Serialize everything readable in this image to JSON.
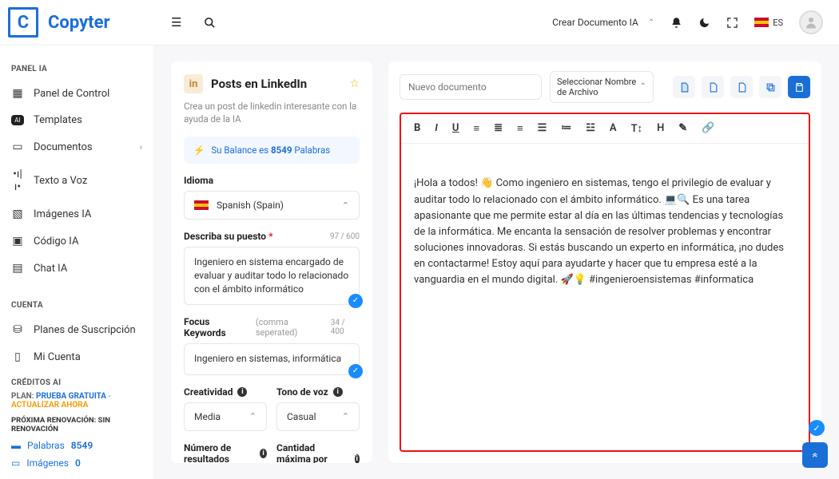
{
  "app": {
    "logo_letter": "C",
    "logo_text": "Copyter"
  },
  "topbar": {
    "crear_label": "Crear Documento IA",
    "lang_code": "ES"
  },
  "sidebar": {
    "section_panel": "PANEL IA",
    "items_panel": [
      {
        "icon": "grid",
        "label": "Panel de Control"
      },
      {
        "icon": "ai",
        "label": "Templates"
      },
      {
        "icon": "doc",
        "label": "Documentos",
        "chev": true
      },
      {
        "icon": "wave",
        "label": "Texto a Voz"
      },
      {
        "icon": "img",
        "label": "Imágenes IA"
      },
      {
        "icon": "code",
        "label": "Código IA"
      },
      {
        "icon": "chat",
        "label": "Chat IA"
      }
    ],
    "section_account": "CUENTA",
    "items_account": [
      {
        "icon": "plan",
        "label": "Planes de Suscripción"
      },
      {
        "icon": "user",
        "label": "Mi Cuenta"
      }
    ],
    "credits_head": "CRÉDITOS AI",
    "plan_prefix": "PLAN:",
    "plan_name": "PRUEBA GRATUITA",
    "plan_sep": "-",
    "plan_action": "ACTUALIZAR AHORA",
    "renov": "PRÓXIMA RENOVACIÓN: SIN RENOVACIÓN",
    "stat_words_label": "Palabras",
    "stat_words_value": "8549",
    "stat_images_label": "Imágenes",
    "stat_images_value": "0"
  },
  "template": {
    "badge": "in",
    "title": "Posts en LinkedIn",
    "desc": "Crea un post de linkedin interesante con la ayuda de la IA",
    "balance_prefix": "Su Balance es",
    "balance_num": "8549",
    "balance_suffix": "Palabras",
    "lang_label": "Idioma",
    "lang_value": "Spanish (Spain)",
    "desc_label": "Describa su puesto",
    "desc_counter": "97 / 600",
    "desc_value": "Ingeniero en sistema encargado de evaluar y auditar todo lo relacionado con el ámbito informático",
    "kw_label": "Focus Keywords",
    "kw_hint": "(comma seperated)",
    "kw_counter": "34 / 400",
    "kw_value": "Ingeniero en sistemas, informática",
    "creativity_label": "Creatividad",
    "creativity_value": "Media",
    "tone_label": "Tono de voz",
    "tone_value": "Casual",
    "results_label": "Número de resultados",
    "maxlen_label": "Cantidad máxima por resultado"
  },
  "document": {
    "new_placeholder": "Nuevo documento",
    "archive_label": "Seleccionar Nombre de Archivo",
    "body": "¡Hola a todos! 👋 Como ingeniero en sistemas, tengo el privilegio de evaluar y auditar todo lo relacionado con el ámbito informático. 💻🔍 Es una tarea apasionante que me permite estar al día en las últimas tendencias y tecnologías de la informática. Me encanta la sensación de resolver problemas y encontrar soluciones innovadoras. Si estás buscando un experto en informática, ¡no dudes en contactarme! Estoy aquí para ayudarte y hacer que tu empresa esté a la vanguardia en el mundo digital. 🚀💡 #ingenieroensistemas #informatica"
  }
}
